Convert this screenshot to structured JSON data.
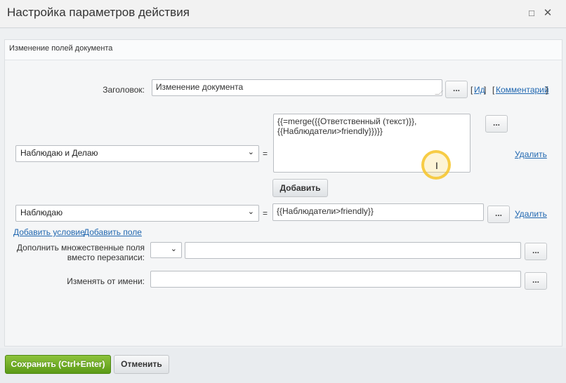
{
  "dialog": {
    "title": "Настройка параметров действия",
    "section_title": "Изменение полей документа"
  },
  "fields": {
    "title_label": "Заголовок:",
    "title_value": "Изменение документа",
    "id_link": "Ид",
    "comment_link": "Комментарий",
    "row1_select": "Наблюдаю и Делаю",
    "row1_value": "{{=merge({{Ответственный (текст)}},\n{{Наблюдатели>friendly}})}}",
    "row2_select": "Наблюдаю",
    "row2_value": "{{Наблюдатели>friendly}}",
    "equals": "=",
    "delete_link": "Удалить",
    "add_button": "Добавить",
    "add_condition_link": "Добавить условие",
    "add_field_link": "Добавить поле",
    "multi_label": "Дополнить множественные поля вместо перезаписи:",
    "multi_select": "",
    "multi_value": "",
    "author_label": "Изменять от имени:",
    "author_value": "",
    "dots": "..."
  },
  "footer": {
    "save_label": "Сохранить (Ctrl+Enter)",
    "cancel_label": "Отменить"
  },
  "icons": {
    "maximize": "□",
    "close": "✕",
    "chevron": "⌄",
    "text_cursor": "I"
  },
  "colors": {
    "accent_green": "#6aa82a",
    "link_blue": "#2067b0"
  }
}
